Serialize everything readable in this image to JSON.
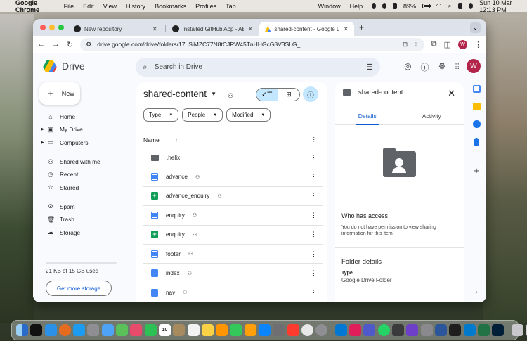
{
  "menubar": {
    "app_name": "Google Chrome",
    "items": [
      "File",
      "Edit",
      "View",
      "History",
      "Bookmarks",
      "Profiles",
      "Tab",
      "Window",
      "Help"
    ],
    "battery": "89%",
    "datetime": "Sun 10 Mar  12:13 PM"
  },
  "browser": {
    "tabs": [
      {
        "title": "New repository",
        "active": false
      },
      {
        "title": "Installed GitHub App - AEM C",
        "active": false
      },
      {
        "title": "shared-content - Google Driv",
        "active": true
      }
    ],
    "url": "drive.google.com/drive/folders/17LSiMZC77N8tCJRW45TnHHGcG8V3SLG_",
    "profile_initial": "W"
  },
  "drive": {
    "logo_text": "Drive",
    "search_placeholder": "Search in Drive",
    "user_initial": "W",
    "new_label": "New",
    "nav": [
      {
        "label": "Home",
        "icon": "home-icon"
      },
      {
        "label": "My Drive",
        "icon": "drive-icon",
        "expandable": true
      },
      {
        "label": "Computers",
        "icon": "computer-icon",
        "expandable": true
      },
      {
        "label": "Shared with me",
        "icon": "people-icon"
      },
      {
        "label": "Recent",
        "icon": "clock-icon"
      },
      {
        "label": "Starred",
        "icon": "star-icon"
      },
      {
        "label": "Spam",
        "icon": "spam-icon"
      },
      {
        "label": "Trash",
        "icon": "trash-icon"
      },
      {
        "label": "Storage",
        "icon": "cloud-icon"
      }
    ],
    "storage_used": "21 KB of 15 GB used",
    "get_storage_label": "Get more storage",
    "folder_title": "shared-content",
    "filters": [
      "Type",
      "People",
      "Modified"
    ],
    "column_name": "Name",
    "files": [
      {
        "name": ".helix",
        "type": "folder",
        "shared": false
      },
      {
        "name": "advance",
        "type": "doc",
        "shared": true
      },
      {
        "name": "advance_enquiry",
        "type": "sheet",
        "shared": true
      },
      {
        "name": "enquiry",
        "type": "doc",
        "shared": true
      },
      {
        "name": "enquiry",
        "type": "sheet",
        "shared": true
      },
      {
        "name": "footer",
        "type": "doc",
        "shared": true
      },
      {
        "name": "index",
        "type": "doc",
        "shared": true
      },
      {
        "name": "nav",
        "type": "doc",
        "shared": true
      }
    ]
  },
  "details": {
    "title": "shared-content",
    "tabs": [
      "Details",
      "Activity"
    ],
    "who_has_access": "Who has access",
    "access_text": "You do not have permission to view sharing information for this item",
    "folder_details": "Folder details",
    "type_label": "Type",
    "type_value": "Google Drive Folder"
  },
  "colors": {
    "accent": "#0b57d0",
    "selected": "#c2e7ff",
    "avatar": "#b3244a"
  }
}
